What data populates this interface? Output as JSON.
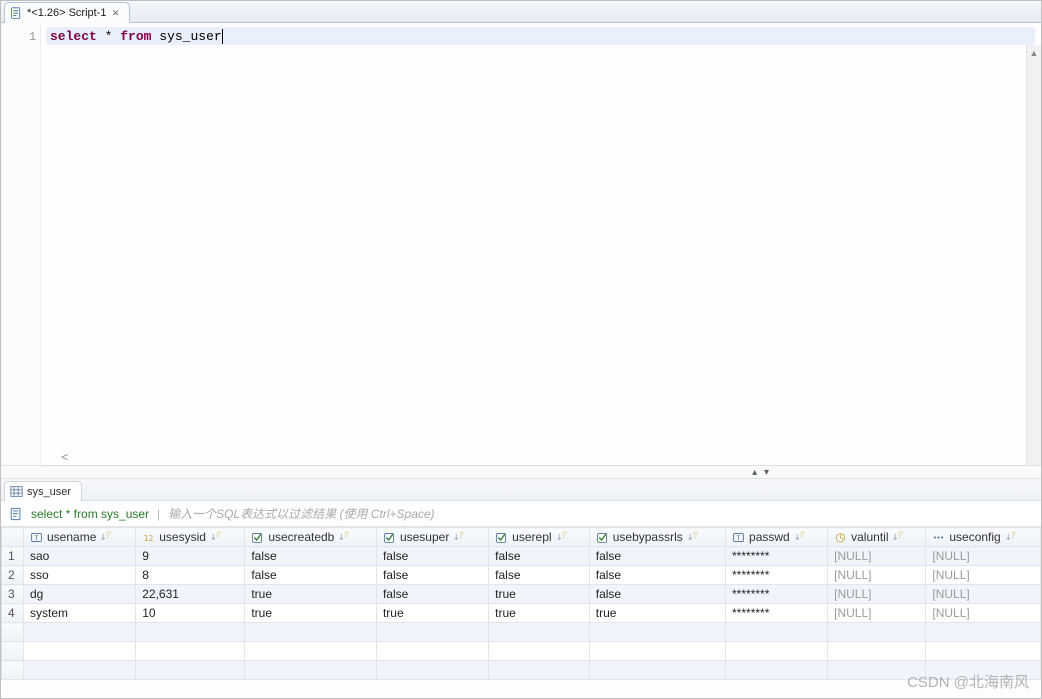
{
  "editor": {
    "tab_label": "*<1.26> Script-1",
    "line_number": "1",
    "code_tokens": {
      "select": "select",
      "star": "*",
      "from": "from",
      "table": "sys_user"
    }
  },
  "split": {
    "toggle_glyph": "▴ ▾"
  },
  "results": {
    "tab_label": "sys_user",
    "sql_text": "select * from sys_user",
    "filter_hint": "输入一个SQL表达式以过滤结果  (使用 Ctrl+Space)",
    "columns": [
      {
        "name": "usename",
        "type": "text"
      },
      {
        "name": "usesysid",
        "type": "num"
      },
      {
        "name": "usecreatedb",
        "type": "bool"
      },
      {
        "name": "usesuper",
        "type": "bool"
      },
      {
        "name": "userepl",
        "type": "bool"
      },
      {
        "name": "usebypassrls",
        "type": "bool"
      },
      {
        "name": "passwd",
        "type": "text"
      },
      {
        "name": "valuntil",
        "type": "ts"
      },
      {
        "name": "useconfig",
        "type": "arr"
      }
    ],
    "rows": [
      {
        "n": "1",
        "usename": "sao",
        "usesysid": "9",
        "usecreatedb": "false",
        "usesuper": "false",
        "userepl": "false",
        "usebypassrls": "false",
        "passwd": "********",
        "valuntil": "[NULL]",
        "useconfig": "[NULL]"
      },
      {
        "n": "2",
        "usename": "sso",
        "usesysid": "8",
        "usecreatedb": "false",
        "usesuper": "false",
        "userepl": "false",
        "usebypassrls": "false",
        "passwd": "********",
        "valuntil": "[NULL]",
        "useconfig": "[NULL]"
      },
      {
        "n": "3",
        "usename": "dg",
        "usesysid": "22,631",
        "usecreatedb": "true",
        "usesuper": "false",
        "userepl": "true",
        "usebypassrls": "false",
        "passwd": "********",
        "valuntil": "[NULL]",
        "useconfig": "[NULL]"
      },
      {
        "n": "4",
        "usename": "system",
        "usesysid": "10",
        "usecreatedb": "true",
        "usesuper": "true",
        "userepl": "true",
        "usebypassrls": "true",
        "passwd": "********",
        "valuntil": "[NULL]",
        "useconfig": "[NULL]"
      }
    ]
  },
  "watermark": "CSDN @北海南风"
}
